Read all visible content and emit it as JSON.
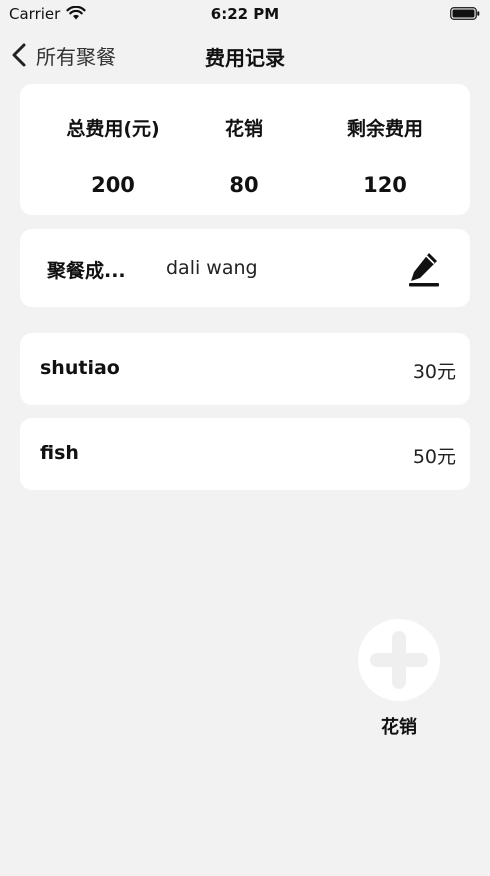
{
  "status_bar": {
    "carrier": "Carrier",
    "time": "6:22 PM"
  },
  "nav": {
    "back_label": "所有聚餐",
    "title": "费用记录"
  },
  "summary": {
    "total_label": "总费用(元)",
    "total_value": "200",
    "spent_label": "花销",
    "spent_value": "80",
    "remaining_label": "剩余费用",
    "remaining_value": "120"
  },
  "member": {
    "label": "聚餐成...",
    "names": "dali wang"
  },
  "expenses": [
    {
      "name": "shutiao",
      "amount": "30元"
    },
    {
      "name": "fish",
      "amount": "50元"
    }
  ],
  "add": {
    "label": "花销"
  },
  "icons": {
    "back": "chevron-left-icon",
    "edit": "pencil-icon",
    "add": "plus-icon",
    "wifi": "wifi-icon",
    "battery": "battery-icon"
  },
  "colors": {
    "background": "#f2f2f2",
    "card": "#ffffff",
    "add_plus": "#efefef",
    "text": "#111111"
  }
}
